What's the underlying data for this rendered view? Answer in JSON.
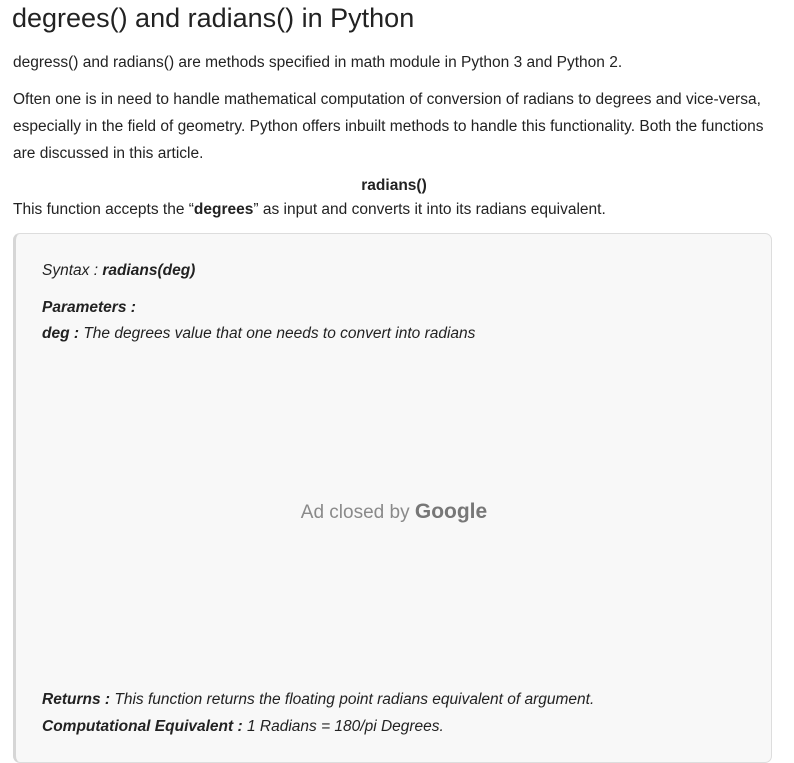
{
  "article": {
    "title": "degrees() and radians() in Python",
    "intro": "degress() and radians() are methods specified in math module in Python 3 and Python 2.",
    "overview": "Often one is in need to handle mathematical computation of conversion of radians to degrees and vice-versa, especially in the field of geometry. Python offers inbuilt methods to handle this functionality. Both the functions are discussed in this article.",
    "section_heading": "radians()",
    "section_desc_before": "This function accepts the “",
    "section_desc_bold": "degrees",
    "section_desc_after": "” as input and converts it into its radians equivalent."
  },
  "details_box": {
    "syntax_label": "Syntax : ",
    "syntax_value": "radians(deg)",
    "parameters_label": "Parameters :",
    "param_name": "deg :",
    "param_desc": " The degrees value that one needs to convert into radians",
    "returns_label": "Returns :",
    "returns_desc": " This function returns the floating point radians equivalent of argument.",
    "computational_label": "Computational Equivalent :",
    "computational_desc": " 1 Radians = 180/pi Degrees."
  },
  "ad": {
    "text": "Ad closed by ",
    "brand": "Google"
  }
}
